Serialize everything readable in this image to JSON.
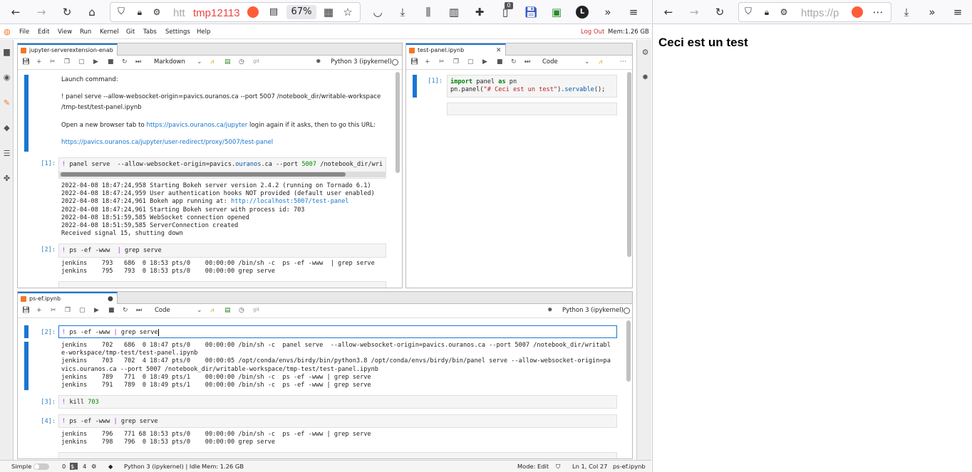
{
  "left_browser": {
    "url_text": "htt",
    "tab_title": "tmp12113",
    "zoom": "67%",
    "badge_count": "0",
    "avatar_letter": "L"
  },
  "right_browser": {
    "url_text": "https://p"
  },
  "jupyter": {
    "menu": [
      "File",
      "Edit",
      "View",
      "Run",
      "Kernel",
      "Git",
      "Tabs",
      "Settings",
      "Help"
    ],
    "logout": "Log Out",
    "mem": "Mem:1.26 GB",
    "panel1": {
      "tab": "jupyter-serverextension-enab",
      "cell_type": "Markdown",
      "kernel": "Python 3 (ipykernel)",
      "md_line1": "Launch command:",
      "md_line2": "! panel serve --allow-websocket-origin=pavics.ouranos.ca --port 5007 /notebook_dir/writable-workspace",
      "md_line3": "/tmp-test/test-panel.ipynb",
      "md_line4_pre": "Open a new browser tab to ",
      "md_line4_link": "https://pavics.ouranos.ca/jupyter",
      "md_line4_post": " login again if it asks, then to go this URL:",
      "md_line5_link": "https://pavics.ouranos.ca/jupyter/user-redirect/proxy/5007/test-panel",
      "cell1_prompt": "[1]:",
      "cell1_out": [
        "2022-04-08 18:47:24,958 Starting Bokeh server version 2.4.2 (running on Tornado 6.1)",
        "2022-04-08 18:47:24,959 User authentication hooks NOT provided (default user enabled)",
        "2022-04-08 18:47:24,961 Bokeh app running at: ",
        "2022-04-08 18:47:24,961 Starting Bokeh server with process id: 703",
        "2022-04-08 18:51:59,585 WebSocket connection opened",
        "2022-04-08 18:51:59,585 ServerConnection created",
        "Received signal 15, shutting down"
      ],
      "bokeh_link": "http://localhost:5007/test-panel",
      "cell2_prompt": "[2]:",
      "cell2_out": [
        "jenkins    793   686  0 18:53 pts/0    00:00:00 /bin/sh -c  ps -ef -www  | grep serve",
        "jenkins    795   793  0 18:53 pts/0    00:00:00 grep serve"
      ]
    },
    "panel2": {
      "tab": "test-panel.ipynb",
      "cell_type": "Code",
      "cell1_prompt": "[1]:"
    },
    "panel3": {
      "tab": "ps-ef.ipynb",
      "cell_type": "Code",
      "kernel": "Python 3 (ipykernel)",
      "c2_prompt": "[2]:",
      "c2_out": [
        "jenkins    702   686  0 18:47 pts/0    00:00:00 /bin/sh -c  panel serve  --allow-websocket-origin=pavics.ouranos.ca --port 5007 /notebook_dir/writabl",
        "e-workspace/tmp-test/test-panel.ipynb",
        "jenkins    703   702  4 18:47 pts/0    00:00:05 /opt/conda/envs/birdy/bin/python3.8 /opt/conda/envs/birdy/bin/panel serve --allow-websocket-origin=pa",
        "vics.ouranos.ca --port 5007 /notebook_dir/writable-workspace/tmp-test/test-panel.ipynb",
        "jenkins    789   771  0 18:49 pts/1    00:00:00 /bin/sh -c  ps -ef -www | grep serve",
        "jenkins    791   789  0 18:49 pts/1    00:00:00 /bin/sh -c  ps -ef -www | grep serve"
      ],
      "c3_prompt": "[3]:",
      "c3_kill": "703",
      "c4_prompt": "[4]:",
      "c4_out": [
        "jenkins    796   771 68 18:53 pts/0    00:00:00 /bin/sh -c  ps -ef -www | grep serve",
        "jenkins    798   796  0 18:53 pts/0    00:00:00 grep serve"
      ]
    },
    "status": {
      "mode_label": "Simple",
      "n1": "0",
      "n2": "4",
      "kernel_state": "Python 3 (ipykernel) | Idle",
      "mem": "Mem: 1.26 GB",
      "mode_edit": "Mode: Edit",
      "position": "Ln 1, Col 27",
      "file": "ps-ef.ipynb"
    }
  },
  "bokeh_page": {
    "heading": "Ceci est un test"
  }
}
